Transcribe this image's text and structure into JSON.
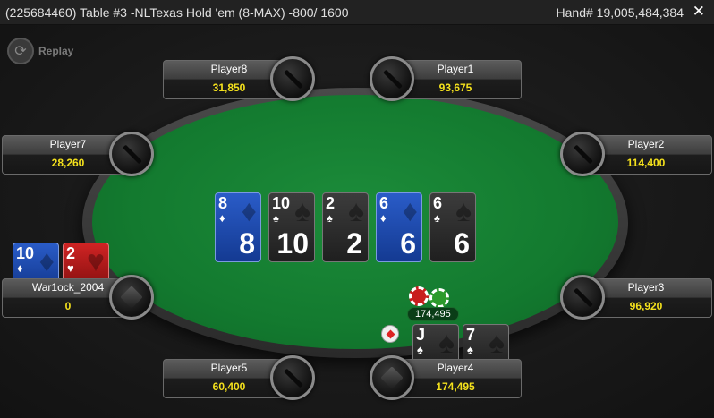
{
  "titlebar": {
    "title": "(225684460) Table #3 -NLTexas Hold 'em (8-MAX) -800/ 1600",
    "hand": "Hand# 19,005,484,384",
    "close": "✕"
  },
  "replay": {
    "label": "Replay",
    "icon": "replay-icon"
  },
  "seats": {
    "player8": {
      "name": "Player8",
      "chips": "31,850"
    },
    "player1": {
      "name": "Player1",
      "chips": "93,675"
    },
    "player7": {
      "name": "Player7",
      "chips": "28,260"
    },
    "player2": {
      "name": "Player2",
      "chips": "114,400"
    },
    "war1ock": {
      "name": "War1ock_2004",
      "chips": "0"
    },
    "player3": {
      "name": "Player3",
      "chips": "96,920"
    },
    "player5": {
      "name": "Player5",
      "chips": "60,400"
    },
    "player4": {
      "name": "Player4",
      "chips": "174,495"
    }
  },
  "board": [
    {
      "rank": "8",
      "suit": "♦",
      "color": "blue"
    },
    {
      "rank": "10",
      "suit": "♠",
      "color": "black"
    },
    {
      "rank": "2",
      "suit": "♠",
      "color": "black"
    },
    {
      "rank": "6",
      "suit": "♦",
      "color": "blue"
    },
    {
      "rank": "6",
      "suit": "♠",
      "color": "black"
    }
  ],
  "hero_cards": [
    {
      "rank": "10",
      "suit": "♦",
      "color": "blue"
    },
    {
      "rank": "2",
      "suit": "♥",
      "color": "red"
    }
  ],
  "player4_cards": [
    {
      "rank": "J",
      "suit": "♠",
      "color": "black"
    },
    {
      "rank": "7",
      "suit": "♠",
      "color": "black"
    }
  ],
  "pot": {
    "amount": "174,495"
  },
  "colors": {
    "chips_text": "#f4e11c",
    "felt": "#137a2f"
  }
}
